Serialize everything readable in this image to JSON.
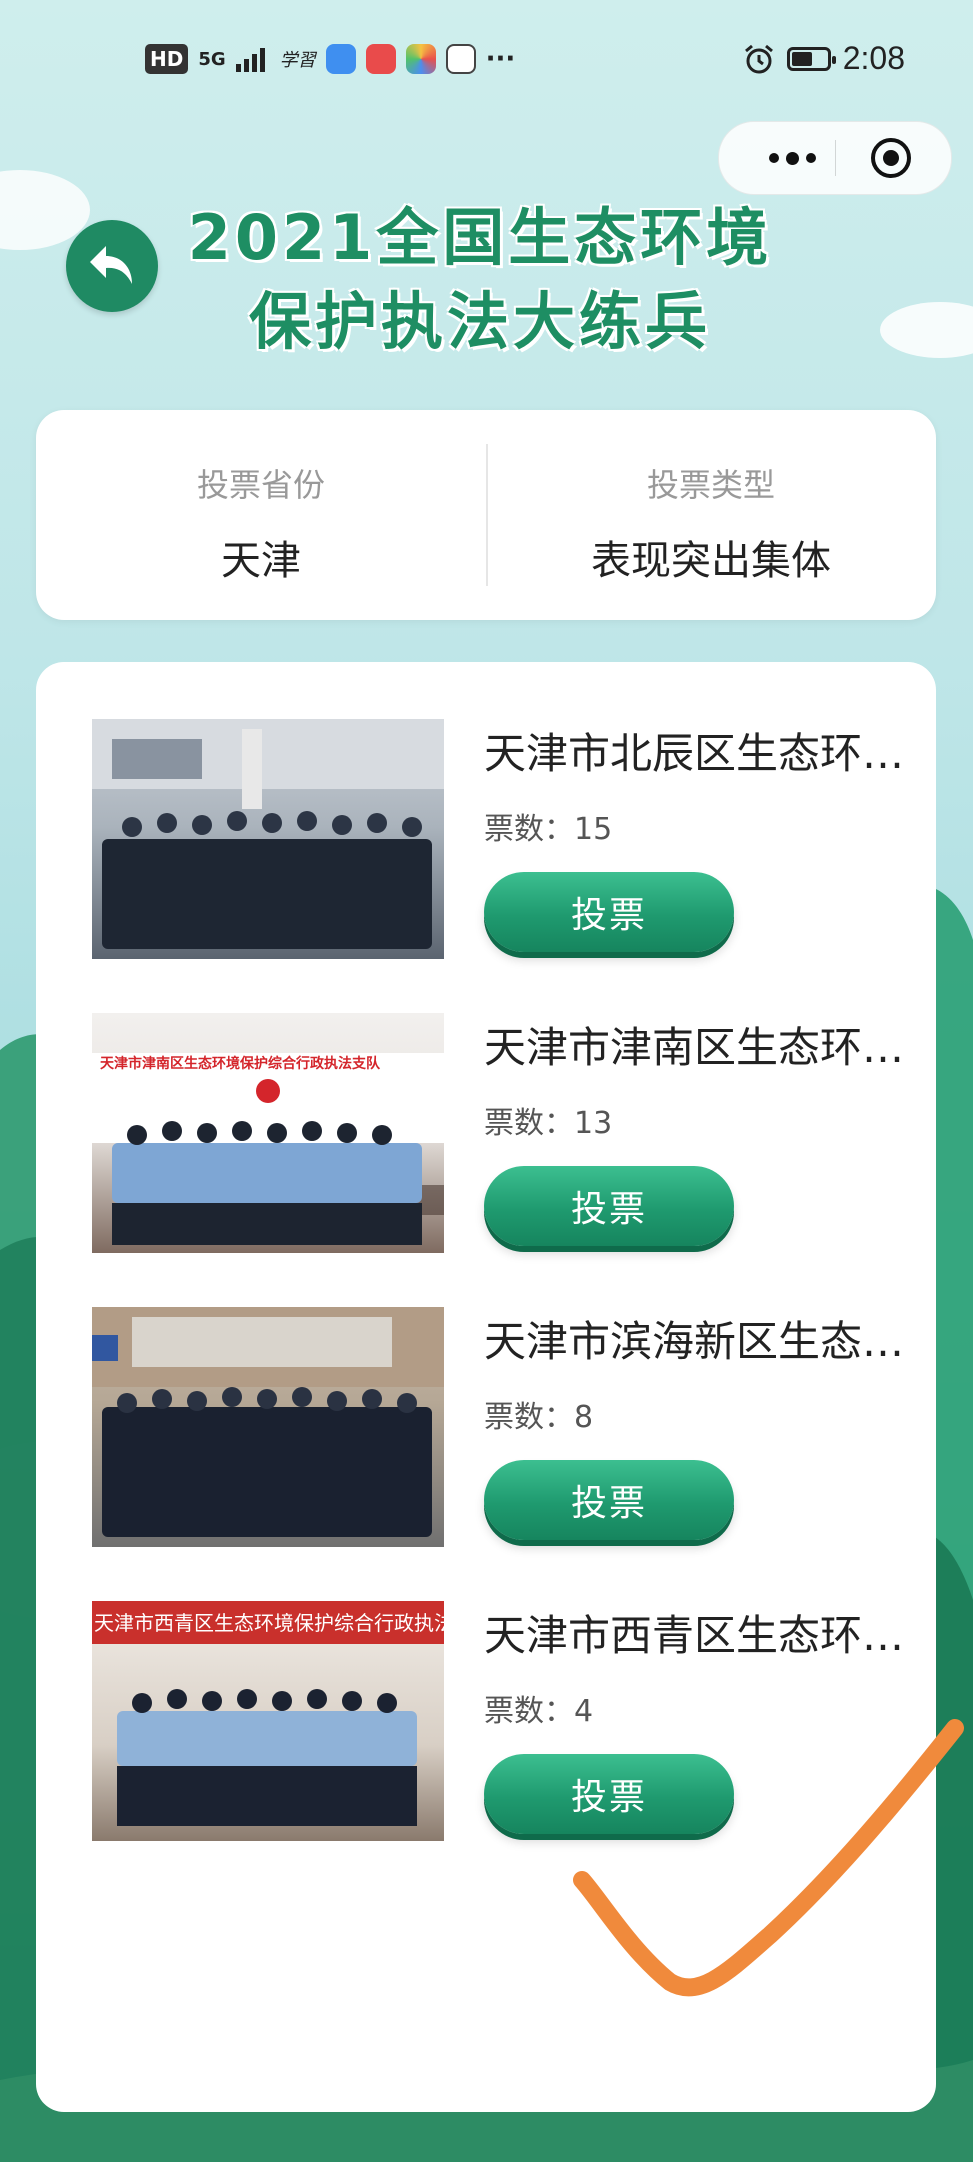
{
  "status_bar": {
    "hd": "HD",
    "network": "5G",
    "app_text": "学習",
    "more": "···",
    "time": "2:08",
    "battery_level": 0.6
  },
  "capsule": {
    "more_icon": "more-dots-icon",
    "close_icon": "target-close-icon"
  },
  "header": {
    "back_icon": "back-arrow-icon",
    "title_line1": "2021全国生态环境",
    "title_line2": "保护执法大练兵"
  },
  "filters": {
    "province_label": "投票省份",
    "province_value": "天津",
    "type_label": "投票类型",
    "type_value": "表现突出集体"
  },
  "list": {
    "votes_prefix": "票数：",
    "vote_label": "投票",
    "items": [
      {
        "name": "天津市北辰区生态环境保护综合行政执法支队",
        "votes": "15",
        "banner": ""
      },
      {
        "name": "天津市津南区生态环境保护综合行政执法支队",
        "votes": "13",
        "banner": "天津市津南区生态环境保护综合行政执法支队"
      },
      {
        "name": "天津市滨海新区生态环境保护综合行政执法支队",
        "votes": "8",
        "banner": ""
      },
      {
        "name": "天津市西青区生态环境保护综合行政执法支队",
        "votes": "4",
        "banner": "天津市西青区生态环境保护综合行政执法支队"
      }
    ]
  },
  "colors": {
    "accent": "#1f8a63",
    "button": "#1f9a6f",
    "check_mark": "#f08a3c"
  }
}
